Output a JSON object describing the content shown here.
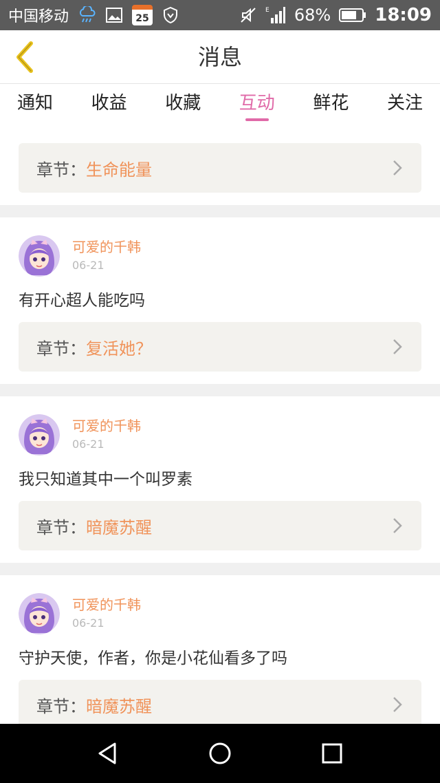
{
  "status_bar": {
    "carrier": "中国移动",
    "calendar_day": "25",
    "battery": "68%",
    "time": "18:09",
    "signal_label": "E"
  },
  "header": {
    "title": "消息"
  },
  "tabs": [
    {
      "label": "通知",
      "active": false
    },
    {
      "label": "收益",
      "active": false
    },
    {
      "label": "收藏",
      "active": false
    },
    {
      "label": "互动",
      "active": true
    },
    {
      "label": "鲜花",
      "active": false
    },
    {
      "label": "关注",
      "active": false
    }
  ],
  "chapter_prefix": "章节：",
  "first_chapter": "生命能量",
  "items": [
    {
      "user": "可爱的千韩",
      "date": "06-21",
      "comment": "有开心超人能吃吗",
      "chapter": "复活她？"
    },
    {
      "user": "可爱的千韩",
      "date": "06-21",
      "comment": "我只知道其中一个叫罗素",
      "chapter": "暗魔苏醒"
    },
    {
      "user": "可爱的千韩",
      "date": "06-21",
      "comment": "守护天使，作者，你是小花仙看多了吗",
      "chapter": "暗魔苏醒"
    }
  ],
  "colors": {
    "accent_pink": "#e06aa8",
    "accent_orange": "#f0935a",
    "back_arrow": "#e8c31e"
  }
}
